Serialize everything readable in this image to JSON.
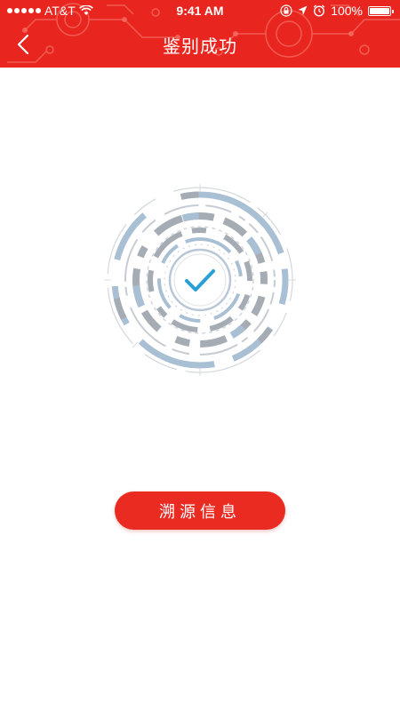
{
  "status_bar": {
    "carrier": "AT&T",
    "time": "9:41 AM",
    "battery_percent": "100%",
    "battery_level": 1.0,
    "icons": [
      "signal-dots-icon",
      "wifi-icon",
      "lock-rotation-icon",
      "location-icon",
      "alarm-icon",
      "battery-icon"
    ]
  },
  "header": {
    "title": "鉴别成功",
    "back_icon": "chevron-left-icon"
  },
  "result": {
    "icon": "checkmark-icon"
  },
  "actions": {
    "trace_label": "溯源信息"
  },
  "colors": {
    "brand_red": "#e8261f",
    "button_red": "#ea2b22",
    "check_blue": "#2a9fd8",
    "ring_gray": "#a6acb3",
    "ring_blue": "#a9bfd3"
  }
}
